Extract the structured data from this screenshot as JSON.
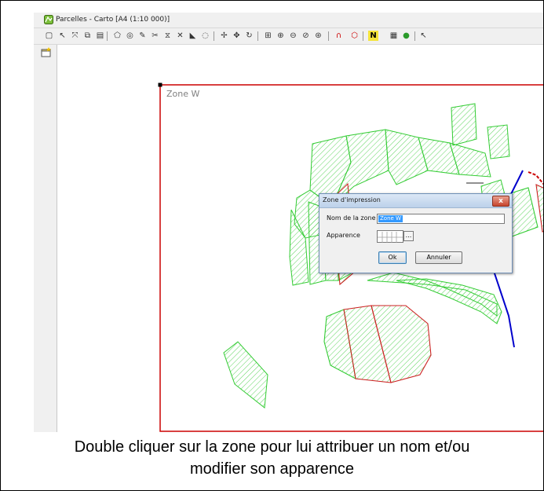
{
  "window": {
    "title": "Parcelles - Carto [A4 (1:10 000)]"
  },
  "toolbar": {
    "icons": [
      "new-doc-icon",
      "pointer-icon",
      "multi-select-icon",
      "copy-icon",
      "paste-icon",
      "polygon-icon",
      "circle-icon",
      "pencil-icon",
      "split-icon",
      "merge-icon",
      "cut-icon",
      "bucket-icon",
      "lasso-icon",
      "north-arrow-icon",
      "move-icon",
      "rotate-icon",
      "zoom-window-icon",
      "zoom-in-icon",
      "zoom-out-icon",
      "zoom-previous-icon",
      "zoom-extent-icon",
      "magnet-icon",
      "vertex-icon",
      "north-symbol-icon",
      "legend-icon",
      "layer-color-icon",
      "help-pointer-icon"
    ],
    "north_label": "N"
  },
  "map": {
    "zone_label": "Zone W",
    "colors": {
      "zone_border": "#cc0000",
      "parcel_green": "#33cc33",
      "parcel_red": "#cc2222",
      "line_blue": "#0000cc"
    }
  },
  "dialog": {
    "title": "Zone d'impression",
    "close_symbol": "x",
    "name_label": "Nom de la zone",
    "name_value": "Zone W",
    "appearance_label": "Apparence",
    "ellipsis": "...",
    "ok_label": "Ok",
    "cancel_label": "Annuler"
  },
  "caption": {
    "line1": "Double cliquer sur la zone pour lui attribuer un nom et/ou",
    "line2": "modifier son apparence"
  }
}
